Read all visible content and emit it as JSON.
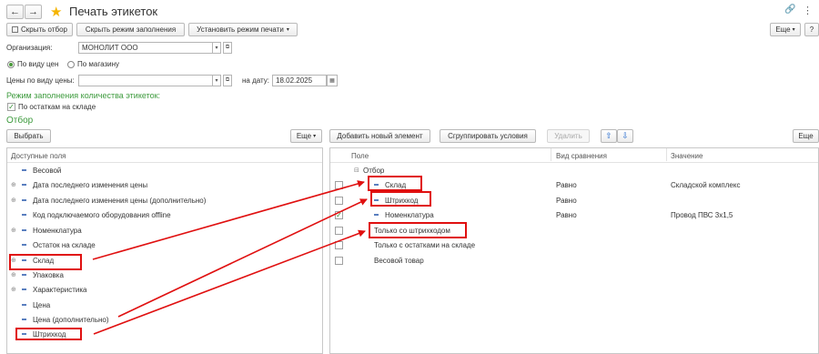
{
  "window": {
    "title": "Печать этикеток",
    "menu_icon": "⋮"
  },
  "toolbar": {
    "hide_filter": "Скрыть отбор",
    "hide_fill_mode": "Скрыть режим заполнения",
    "set_print_mode": "Установить режим печати",
    "more": "Еще",
    "help": "?"
  },
  "form": {
    "org_label": "Организация:",
    "org_value": "МОНОЛИТ ООО",
    "radio_price_type": "По виду цен",
    "radio_store": "По магазину",
    "price_type_label": "Цены по виду цены:",
    "price_type_value": "",
    "date_label": "на дату:",
    "date_value": "18.02.2025",
    "fill_mode_title": "Режим заполнения количества этикеток:",
    "by_stock_checkbox": "По остаткам на складе",
    "filter_title": "Отбор"
  },
  "left_panel": {
    "select_button": "Выбрать",
    "more": "Еще",
    "header": "Доступные поля",
    "items": [
      {
        "label": "Весовой",
        "expandable": false
      },
      {
        "label": "Дата последнего изменения цены",
        "expandable": true
      },
      {
        "label": "Дата последнего изменения цены (дополнительно)",
        "expandable": true
      },
      {
        "label": "Код подключаемого оборудования offline",
        "expandable": false
      },
      {
        "label": "Номенклатура",
        "expandable": true
      },
      {
        "label": "Остаток на складе",
        "expandable": false
      },
      {
        "label": "Склад",
        "expandable": true
      },
      {
        "label": "Упаковка",
        "expandable": true
      },
      {
        "label": "Характеристика",
        "expandable": true
      },
      {
        "label": "Цена",
        "expandable": false
      },
      {
        "label": "Цена (дополнительно)",
        "expandable": false
      },
      {
        "label": "Штрихкод",
        "expandable": false
      }
    ]
  },
  "right_panel": {
    "add_element": "Добавить новый элемент",
    "group_conditions": "Сгруппировать условия",
    "delete": "Удалить",
    "more": "Еще",
    "col_field": "Поле",
    "col_comparison": "Вид сравнения",
    "col_value": "Значение",
    "group_label": "Отбор",
    "rows": [
      {
        "field": "Склад",
        "comparison": "Равно",
        "value": "Складской комплекс",
        "checked": false,
        "dash": true
      },
      {
        "field": "Штрихкод",
        "comparison": "Равно",
        "value": "",
        "checked": false,
        "dash": true
      },
      {
        "field": "Номенклатура",
        "comparison": "Равно",
        "value": "Провод ПВС 3х1,5",
        "checked": true,
        "dash": true
      },
      {
        "field": "Только со штрихкодом",
        "comparison": "",
        "value": "",
        "checked": false,
        "dash": false
      },
      {
        "field": "Только с остатками на складе",
        "comparison": "",
        "value": "",
        "checked": false,
        "dash": false
      },
      {
        "field": "Весовой товар",
        "comparison": "",
        "value": "",
        "checked": false,
        "dash": false
      }
    ]
  },
  "colors": {
    "accent_green": "#3c9a3c",
    "highlight_red": "#e01010",
    "star": "#f5b400",
    "arrow_blue": "#2a6fd1"
  },
  "icons": {
    "back": "←",
    "forward": "→",
    "star": "★",
    "link": "🔗",
    "dropdown": "▾",
    "open": "⧉",
    "calendar": "▦",
    "up": "⇧",
    "down": "⇩"
  }
}
